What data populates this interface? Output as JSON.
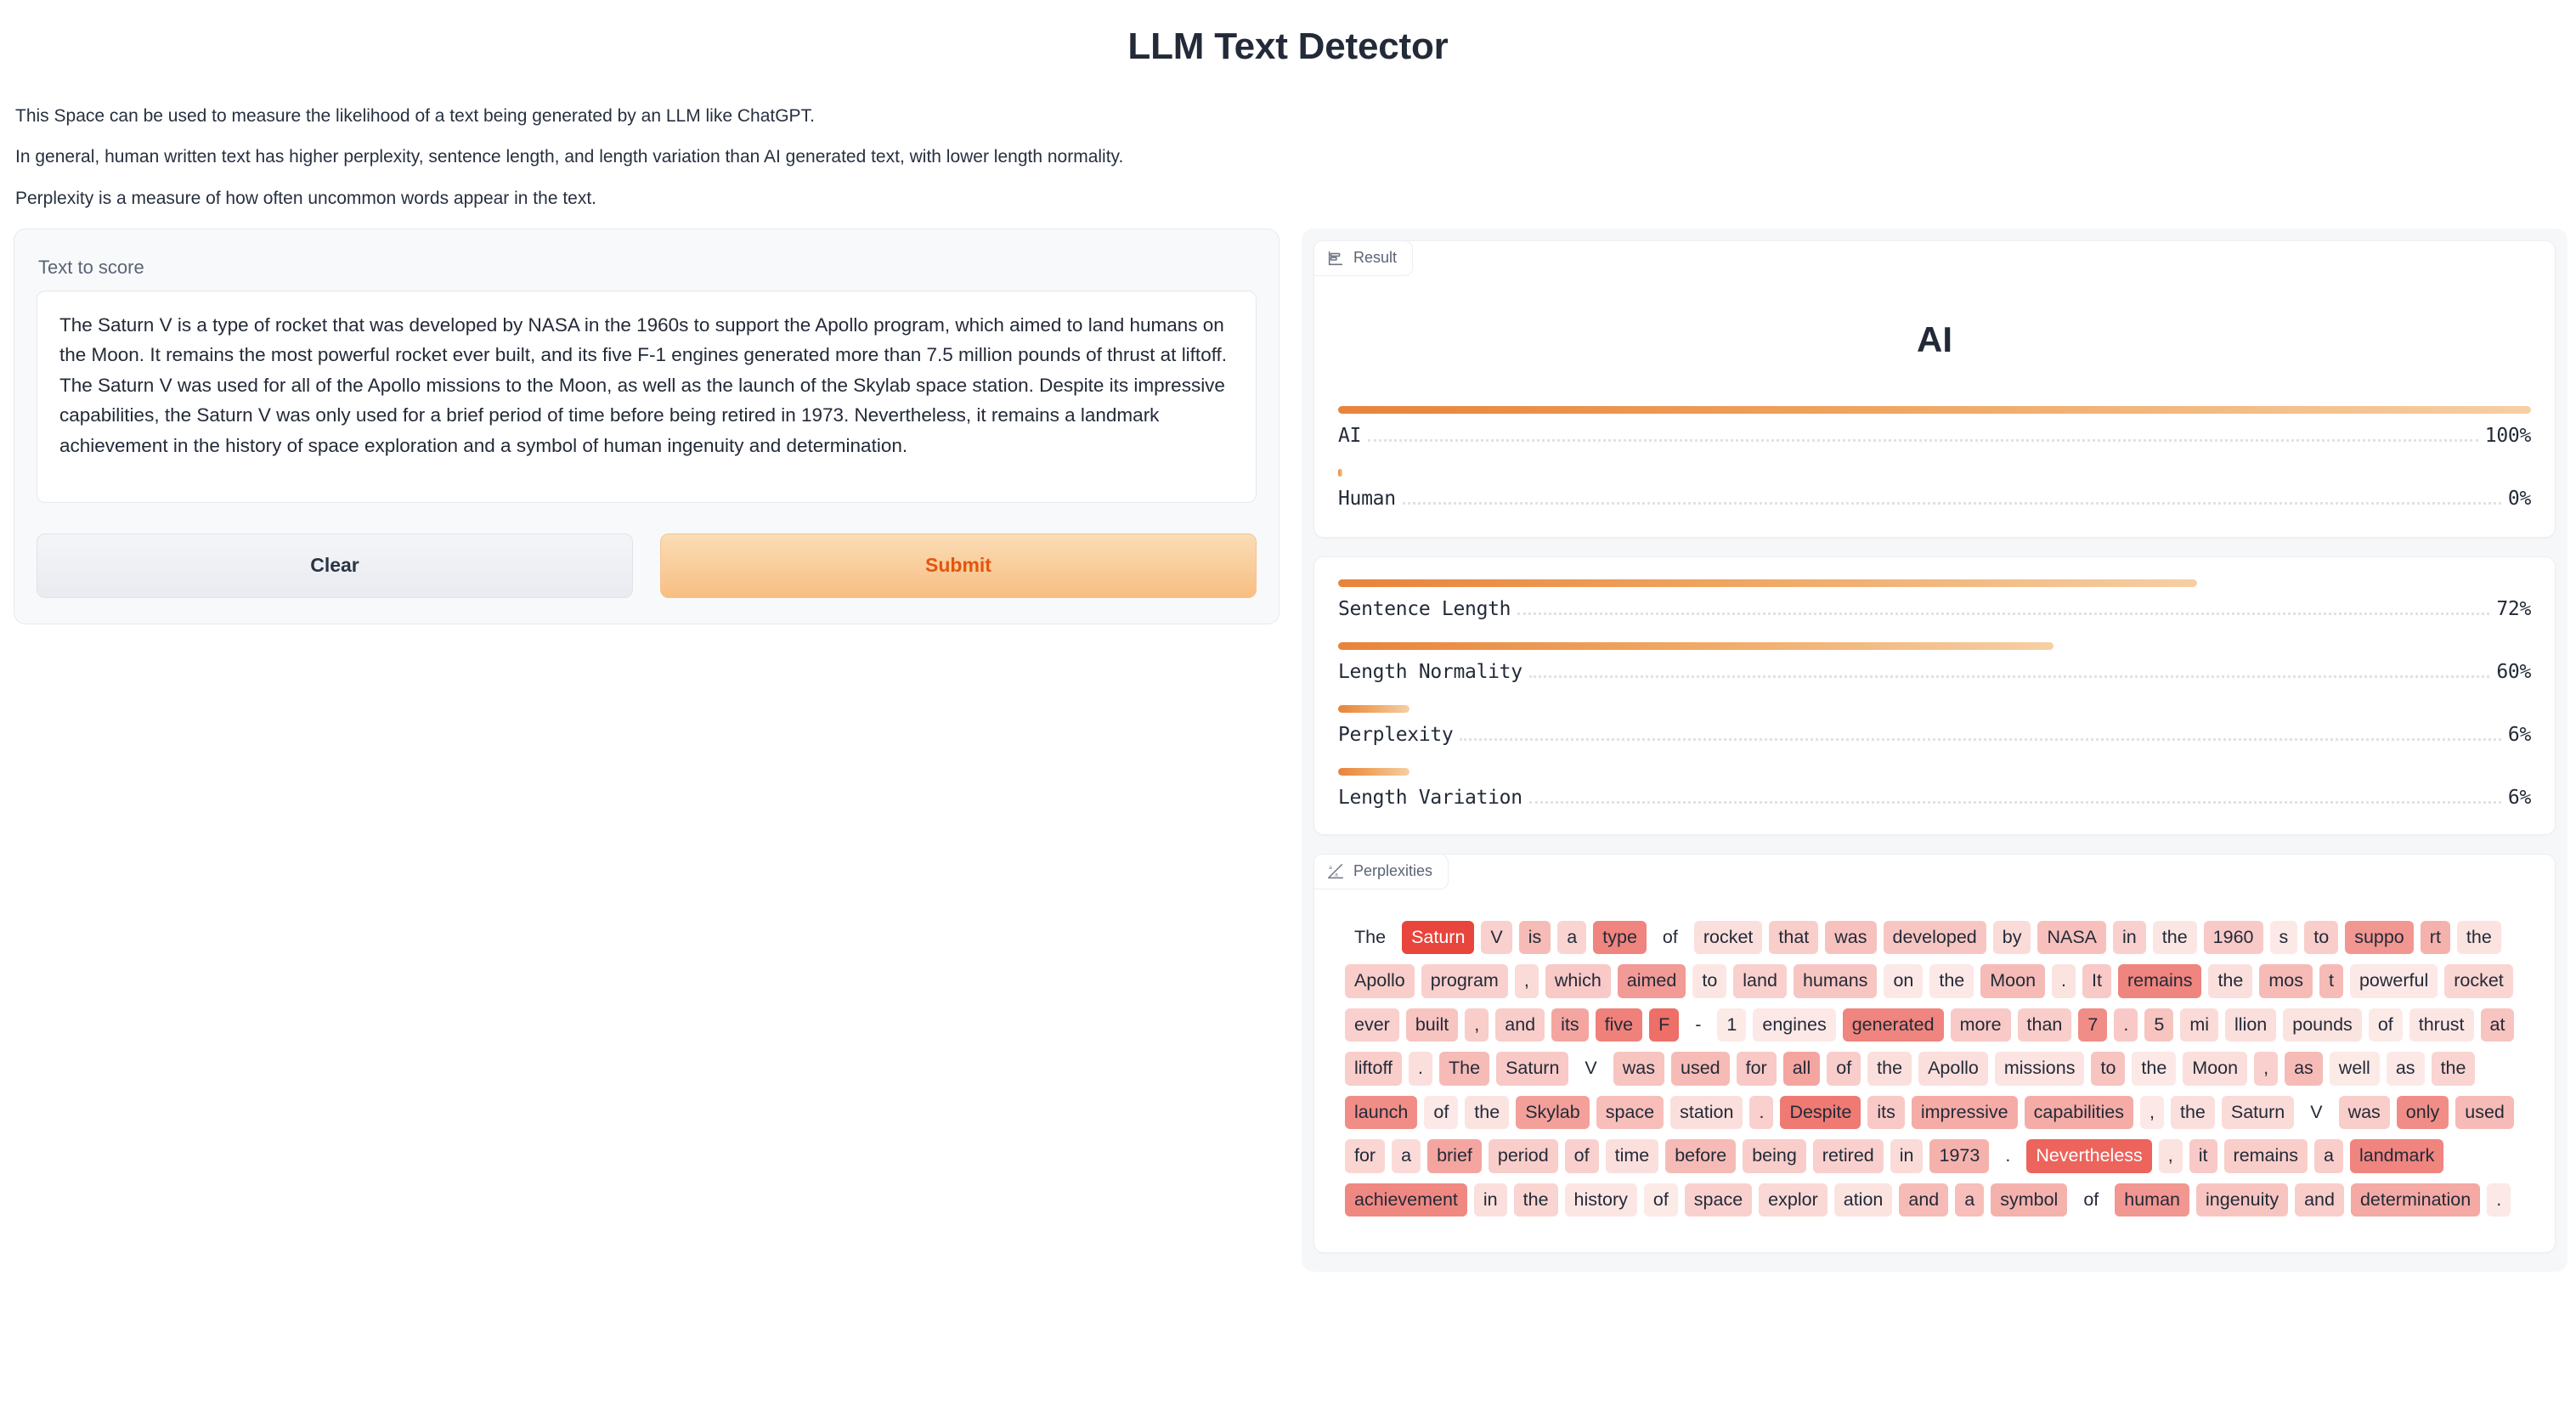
{
  "header": {
    "title": "LLM Text Detector",
    "paragraphs": [
      "This Space can be used to measure the likelihood of a text being generated by an LLM like ChatGPT.",
      "In general, human written text has higher perplexity, sentence length, and length variation than AI generated text, with lower length normality.",
      "Perplexity is a measure of how often uncommon words appear in the text."
    ]
  },
  "form": {
    "field_label": "Text to score",
    "text_value": "The Saturn V is a type of rocket that was developed by NASA in the 1960s to support the Apollo program, which aimed to land humans on the Moon. It remains the most powerful rocket ever built, and its five F-1 engines generated more than 7.5 million pounds of thrust at liftoff. The Saturn V was used for all of the Apollo missions to the Moon, as well as the launch of the Skylab space station. Despite its impressive capabilities, the Saturn V was only used for a brief period of time before being retired in 1973. Nevertheless, it remains a landmark achievement in the history of space exploration and a symbol of human ingenuity and determination.",
    "text_placeholder": "Text to score",
    "clear_label": "Clear",
    "submit_label": "Submit"
  },
  "result": {
    "tab_label": "Result",
    "tab_icon": "bar-chart-icon",
    "verdict": "AI"
  },
  "perplexities": {
    "tab_label": "Perplexities",
    "tab_icon": "highlight-text-icon"
  },
  "colors": {
    "accent_start": "#e8833a",
    "accent_end": "#f6cfa4",
    "submit_text": "#e2560f",
    "token_high": "#e8453c",
    "token_low": "#fdf1ef",
    "text": "#232a38",
    "muted": "#5a6375"
  },
  "chart_data": [
    {
      "type": "bar",
      "title": "AI",
      "orientation": "horizontal",
      "categories": [
        "AI",
        "Human"
      ],
      "values": [
        100,
        0
      ],
      "value_labels": [
        "100%",
        "0%"
      ],
      "ylim": [
        0,
        100
      ],
      "grid": false,
      "legend": "none"
    },
    {
      "type": "bar",
      "title": "",
      "orientation": "horizontal",
      "categories": [
        "Sentence Length",
        "Length Normality",
        "Perplexity",
        "Length Variation"
      ],
      "values": [
        72,
        60,
        6,
        6
      ],
      "value_labels": [
        "72%",
        "60%",
        "6%",
        "6%"
      ],
      "ylim": [
        0,
        100
      ],
      "grid": false,
      "legend": "none"
    },
    {
      "type": "heatmap",
      "title": "Perplexities",
      "description": "Per-token perplexity highlight; intensity 0-1 mapped to red shading",
      "tokens": [
        {
          "t": "The",
          "v": 0.02
        },
        {
          "t": "Saturn",
          "v": 0.95
        },
        {
          "t": "V",
          "v": 0.18
        },
        {
          "t": "is",
          "v": 0.3
        },
        {
          "t": "a",
          "v": 0.16
        },
        {
          "t": "type",
          "v": 0.6
        },
        {
          "t": "of",
          "v": 0.03
        },
        {
          "t": "rocket",
          "v": 0.1
        },
        {
          "t": "that",
          "v": 0.2
        },
        {
          "t": "was",
          "v": 0.26
        },
        {
          "t": "developed",
          "v": 0.24
        },
        {
          "t": "by",
          "v": 0.12
        },
        {
          "t": "NASA",
          "v": 0.27
        },
        {
          "t": "in",
          "v": 0.18
        },
        {
          "t": "the",
          "v": 0.06
        },
        {
          "t": "1960",
          "v": 0.22
        },
        {
          "t": "s",
          "v": 0.05
        },
        {
          "t": "to",
          "v": 0.2
        },
        {
          "t": "suppo",
          "v": 0.5
        },
        {
          "t": "rt",
          "v": 0.35
        },
        {
          "t": "the",
          "v": 0.08
        },
        {
          "t": "Apollo",
          "v": 0.2
        },
        {
          "t": "program",
          "v": 0.18
        },
        {
          "t": ",",
          "v": 0.12
        },
        {
          "t": "which",
          "v": 0.22
        },
        {
          "t": "aimed",
          "v": 0.48
        },
        {
          "t": "to",
          "v": 0.06
        },
        {
          "t": "land",
          "v": 0.18
        },
        {
          "t": "humans",
          "v": 0.24
        },
        {
          "t": "on",
          "v": 0.05
        },
        {
          "t": "the",
          "v": 0.05
        },
        {
          "t": "Moon",
          "v": 0.3
        },
        {
          "t": ".",
          "v": 0.08
        },
        {
          "t": "It",
          "v": 0.22
        },
        {
          "t": "remains",
          "v": 0.6
        },
        {
          "t": "the",
          "v": 0.1
        },
        {
          "t": "mos",
          "v": 0.3
        },
        {
          "t": "t",
          "v": 0.3
        },
        {
          "t": "powerful",
          "v": 0.05
        },
        {
          "t": "rocket",
          "v": 0.15
        },
        {
          "t": "ever",
          "v": 0.18
        },
        {
          "t": "built",
          "v": 0.25
        },
        {
          "t": ",",
          "v": 0.2
        },
        {
          "t": "and",
          "v": 0.2
        },
        {
          "t": "its",
          "v": 0.42
        },
        {
          "t": "five",
          "v": 0.62
        },
        {
          "t": "F",
          "v": 0.72
        },
        {
          "t": "-",
          "v": 0.02
        },
        {
          "t": "1",
          "v": 0.04
        },
        {
          "t": "engines",
          "v": 0.05
        },
        {
          "t": "generated",
          "v": 0.6
        },
        {
          "t": "more",
          "v": 0.22
        },
        {
          "t": "than",
          "v": 0.2
        },
        {
          "t": "7",
          "v": 0.55
        },
        {
          "t": ".",
          "v": 0.22
        },
        {
          "t": "5",
          "v": 0.25
        },
        {
          "t": "mi",
          "v": 0.12
        },
        {
          "t": "llion",
          "v": 0.1
        },
        {
          "t": "pounds",
          "v": 0.08
        },
        {
          "t": "of",
          "v": 0.04
        },
        {
          "t": "thrust",
          "v": 0.06
        },
        {
          "t": "at",
          "v": 0.25
        },
        {
          "t": "liftoff",
          "v": 0.2
        },
        {
          "t": ".",
          "v": 0.1
        },
        {
          "t": "The",
          "v": 0.3
        },
        {
          "t": "Saturn",
          "v": 0.22
        },
        {
          "t": "V",
          "v": 0.03
        },
        {
          "t": "was",
          "v": 0.25
        },
        {
          "t": "used",
          "v": 0.3
        },
        {
          "t": "for",
          "v": 0.22
        },
        {
          "t": "all",
          "v": 0.42
        },
        {
          "t": "of",
          "v": 0.2
        },
        {
          "t": "the",
          "v": 0.1
        },
        {
          "t": "Apollo",
          "v": 0.1
        },
        {
          "t": "missions",
          "v": 0.07
        },
        {
          "t": "to",
          "v": 0.25
        },
        {
          "t": "the",
          "v": 0.05
        },
        {
          "t": "Moon",
          "v": 0.1
        },
        {
          "t": ",",
          "v": 0.18
        },
        {
          "t": "as",
          "v": 0.3
        },
        {
          "t": "well",
          "v": 0.04
        },
        {
          "t": "as",
          "v": 0.05
        },
        {
          "t": "the",
          "v": 0.16
        },
        {
          "t": "launch",
          "v": 0.55
        },
        {
          "t": "of",
          "v": 0.05
        },
        {
          "t": "the",
          "v": 0.08
        },
        {
          "t": "Skylab",
          "v": 0.45
        },
        {
          "t": "space",
          "v": 0.28
        },
        {
          "t": "station",
          "v": 0.1
        },
        {
          "t": ".",
          "v": 0.18
        },
        {
          "t": "Despite",
          "v": 0.66
        },
        {
          "t": "its",
          "v": 0.22
        },
        {
          "t": "impressive",
          "v": 0.38
        },
        {
          "t": "capabilities",
          "v": 0.38
        },
        {
          "t": ",",
          "v": 0.05
        },
        {
          "t": "the",
          "v": 0.1
        },
        {
          "t": "Saturn",
          "v": 0.12
        },
        {
          "t": "V",
          "v": 0.03
        },
        {
          "t": "was",
          "v": 0.2
        },
        {
          "t": "only",
          "v": 0.55
        },
        {
          "t": "used",
          "v": 0.3
        },
        {
          "t": "for",
          "v": 0.15
        },
        {
          "t": "a",
          "v": 0.12
        },
        {
          "t": "brief",
          "v": 0.42
        },
        {
          "t": "period",
          "v": 0.2
        },
        {
          "t": "of",
          "v": 0.18
        },
        {
          "t": "time",
          "v": 0.1
        },
        {
          "t": "before",
          "v": 0.3
        },
        {
          "t": "being",
          "v": 0.2
        },
        {
          "t": "retired",
          "v": 0.18
        },
        {
          "t": "in",
          "v": 0.12
        },
        {
          "t": "1973",
          "v": 0.35
        },
        {
          "t": ".",
          "v": 0.03
        },
        {
          "t": "Nevertheless",
          "v": 0.78
        },
        {
          "t": ",",
          "v": 0.08
        },
        {
          "t": "it",
          "v": 0.22
        },
        {
          "t": "remains",
          "v": 0.2
        },
        {
          "t": "a",
          "v": 0.2
        },
        {
          "t": "landmark",
          "v": 0.6
        },
        {
          "t": "achievement",
          "v": 0.58
        },
        {
          "t": "in",
          "v": 0.1
        },
        {
          "t": "the",
          "v": 0.16
        },
        {
          "t": "history",
          "v": 0.06
        },
        {
          "t": "of",
          "v": 0.04
        },
        {
          "t": "space",
          "v": 0.18
        },
        {
          "t": "explor",
          "v": 0.14
        },
        {
          "t": "ation",
          "v": 0.08
        },
        {
          "t": "and",
          "v": 0.3
        },
        {
          "t": "a",
          "v": 0.28
        },
        {
          "t": "symbol",
          "v": 0.35
        },
        {
          "t": "of",
          "v": 0.03
        },
        {
          "t": "human",
          "v": 0.5
        },
        {
          "t": "ingenuity",
          "v": 0.25
        },
        {
          "t": "and",
          "v": 0.2
        },
        {
          "t": "determination",
          "v": 0.4
        },
        {
          "t": ".",
          "v": 0.05
        }
      ]
    }
  ]
}
